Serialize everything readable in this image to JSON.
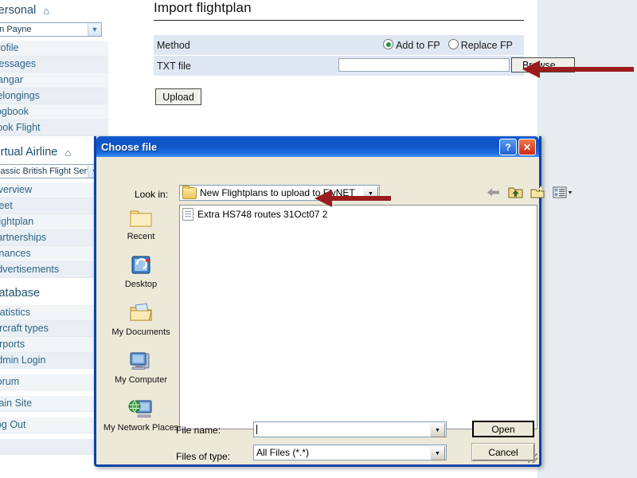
{
  "page": {
    "title": "Import flightplan",
    "form": {
      "method_label": "Method",
      "radio_add_label": "Add to FP",
      "radio_replace_label": "Replace FP",
      "radio_selected": "Add to FP",
      "txtfile_label": "TXT file",
      "txtfile_value": "",
      "browse_label": "Browse...",
      "upload_label": "Upload"
    }
  },
  "sidebar": {
    "sections": [
      {
        "heading": "Personal",
        "select_value": "Ian Payne",
        "items": [
          "Profile",
          "Messages",
          "Hangar",
          "Belongings",
          "Logbook",
          "Book Flight"
        ]
      },
      {
        "heading": "Virtual Airline",
        "select_value": "Classic British Flight Service",
        "items": [
          "Overview",
          "Fleet",
          "Flightplan",
          "Partnerships",
          "Finances",
          "Advertisements"
        ]
      },
      {
        "heading": "Database",
        "select_value": null,
        "items": [
          "Statistics",
          "Aircraft types",
          "Airports",
          "Admin Login"
        ]
      },
      {
        "heading": null,
        "select_value": null,
        "items": [
          "Forum"
        ]
      },
      {
        "heading": null,
        "select_value": null,
        "items": [
          "Main Site"
        ]
      },
      {
        "heading": null,
        "select_value": null,
        "items": [
          "Log Out"
        ]
      }
    ],
    "home_icon": "home-icon"
  },
  "dialog": {
    "title": "Choose file",
    "help_label": "?",
    "close_label": "✕",
    "lookin_label": "Look in:",
    "lookin_value": "New Flightplans to upload to FlyNET",
    "nav": {
      "back": "back-arrow-icon",
      "up": "up-one-level-icon",
      "new_folder": "new-folder-icon",
      "views": "views-icon"
    },
    "places": [
      {
        "label": "Recent",
        "icon": "recent-folder-icon"
      },
      {
        "label": "Desktop",
        "icon": "desktop-icon"
      },
      {
        "label": "My Documents",
        "icon": "my-documents-icon"
      },
      {
        "label": "My Computer",
        "icon": "my-computer-icon"
      },
      {
        "label": "My Network Places",
        "icon": "my-network-places-icon"
      }
    ],
    "files": [
      {
        "name": "Extra HS748 routes 31Oct07 2",
        "icon": "text-document-icon"
      }
    ],
    "filename_label": "File name:",
    "filename_value": "",
    "filetype_label": "Files of type:",
    "filetype_value": "All Files (*.*)",
    "open_label": "Open",
    "cancel_label": "Cancel"
  },
  "annotations": [
    {
      "name": "arrow-to-browse-button",
      "color": "#9b1c1c"
    },
    {
      "name": "arrow-to-file-item",
      "color": "#9b1c1c"
    }
  ]
}
